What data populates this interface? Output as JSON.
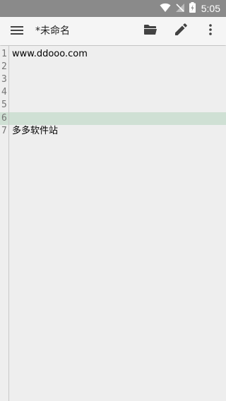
{
  "status_bar": {
    "time": "5:05",
    "background": "#8a8a8a",
    "icons": [
      "wifi-icon",
      "signal-off-icon",
      "battery-charging-icon"
    ]
  },
  "toolbar": {
    "title": "*未命名",
    "menu_icon": "hamburger-menu-icon",
    "actions": [
      "folder-open-icon",
      "pencil-icon",
      "more-vertical-icon"
    ]
  },
  "editor": {
    "highlight_color": "#cfe0d4",
    "current_line": 6,
    "lines": [
      {
        "number": "1",
        "text": "www.ddooo.com"
      },
      {
        "number": "2",
        "text": ""
      },
      {
        "number": "3",
        "text": ""
      },
      {
        "number": "4",
        "text": ""
      },
      {
        "number": "5",
        "text": ""
      },
      {
        "number": "6",
        "text": ""
      },
      {
        "number": "7",
        "text": "多多软件站"
      }
    ]
  }
}
